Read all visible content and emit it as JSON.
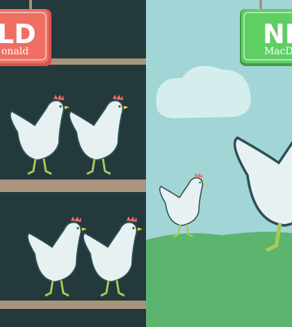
{
  "left_sign": {
    "title": "LD",
    "subtitle": "onald",
    "color": "#ef6f64"
  },
  "right_sign": {
    "title": "NE",
    "subtitle": "MacD",
    "color": "#5fcf64"
  },
  "colors": {
    "barn": "#23393c",
    "shelf": "#a8957c",
    "sky": "#a2d5d6",
    "grass": "#5cb56e",
    "hen": "#e8f1f2",
    "comb": "#ee6b62"
  }
}
